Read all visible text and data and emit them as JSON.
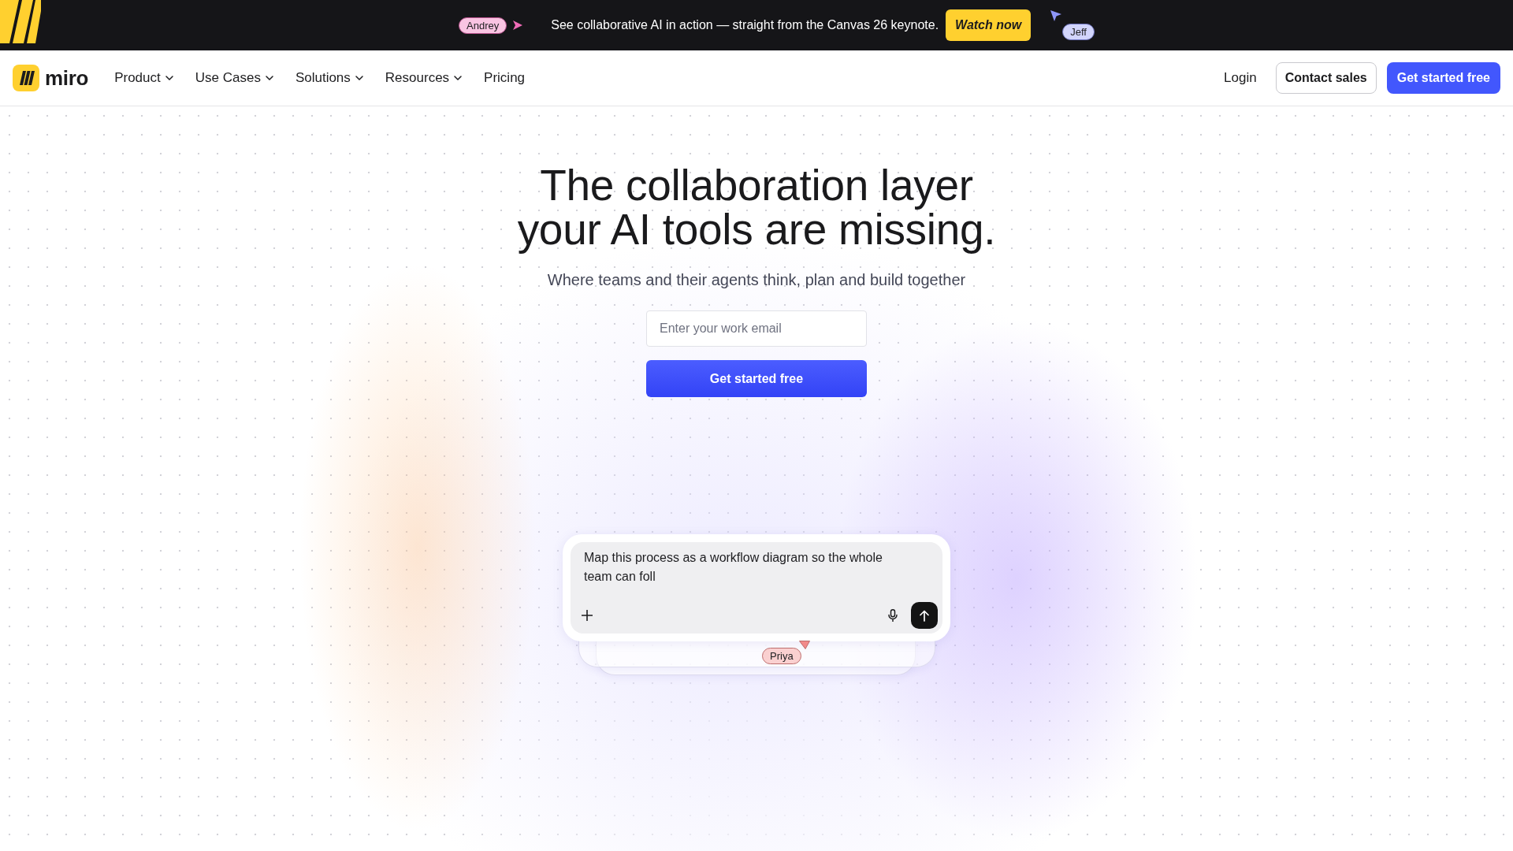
{
  "announcement_bar": {
    "cursors": [
      {
        "name": "Andrey",
        "color": "#f06bb7"
      },
      {
        "name": "Jeff",
        "color": "#8e96f8"
      }
    ],
    "text": "See collaborative AI in action — straight from the Canvas 26 keynote.",
    "button": "Watch now"
  },
  "nav": {
    "brand": "miro",
    "menu": [
      {
        "label": "Product",
        "has_dropdown": true
      },
      {
        "label": "Use Cases",
        "has_dropdown": true
      },
      {
        "label": "Solutions",
        "has_dropdown": true
      },
      {
        "label": "Resources",
        "has_dropdown": true
      },
      {
        "label": "Pricing",
        "has_dropdown": false
      }
    ],
    "login": "Login",
    "contact_button": "Contact sales",
    "cta_button": "Get started free"
  },
  "hero": {
    "heading_lines": [
      "The collaboration layer",
      "your AI tools are missing."
    ],
    "subheading": "Where teams and their agents think, plan and build together",
    "email_field": {
      "placeholder": "Enter your work email"
    },
    "submit_button": "Get started free"
  },
  "prompt_card": {
    "value": "Map this process as a workflow diagram so the whole team can foll",
    "cursors": [
      {
        "name": "Priya",
        "color": "#f28a8a"
      }
    ]
  }
}
